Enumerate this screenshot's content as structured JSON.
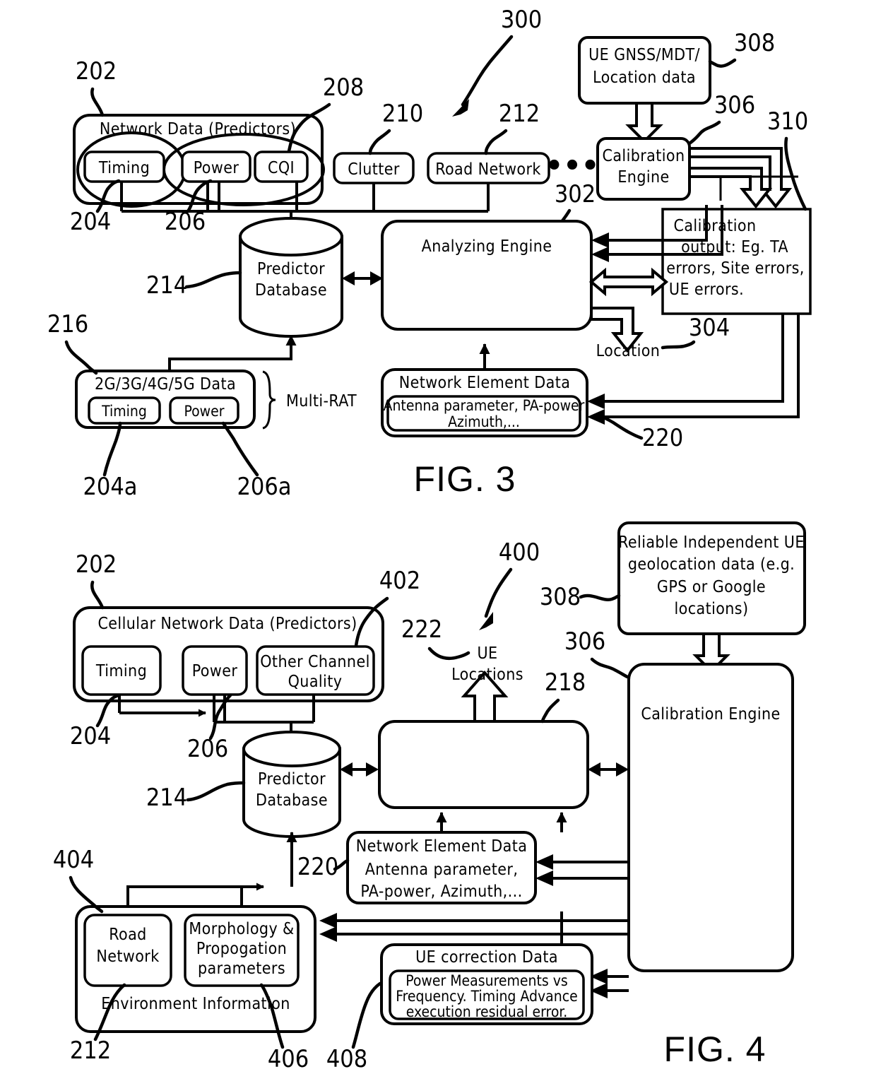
{
  "document": {
    "type": "patent-figure-sheet",
    "figures": [
      "FIG. 3",
      "FIG. 4"
    ]
  },
  "fig3": {
    "caption": "FIG. 3",
    "system_ref": "300",
    "blocks": {
      "network_data": {
        "title": "Network Data  (Predictors)",
        "ref": "202"
      },
      "timing": {
        "label": "Timing",
        "ref": "204"
      },
      "power": {
        "label": "Power",
        "ref": "206"
      },
      "cqi": {
        "label": "CQI",
        "ref": "208"
      },
      "clutter": {
        "label": "Clutter",
        "ref": "210"
      },
      "road_network": {
        "label": "Road  Network",
        "ref": "212"
      },
      "ellipsis": "•••",
      "ellipsis_ref": "302",
      "predictor_db": {
        "label_line1": "Predictor",
        "label_line2": "Database",
        "ref": "214"
      },
      "analyzing_engine": {
        "label": "Analyzing  Engine"
      },
      "ue_gnss": {
        "line1": "UE  GNSS/MDT/",
        "line2": "Location  data",
        "ref": "308"
      },
      "calibration_engine": {
        "line1": "Calibration",
        "line2": "Engine",
        "ref": "306"
      },
      "calibration_output": {
        "line1": "Calibration",
        "line2": "output:  Eg.  TA",
        "line3": "errors,  Site  errors,",
        "line4": "UE  errors.",
        "ref": "310"
      },
      "location_out": {
        "label": "Location",
        "ref": "304"
      },
      "multi_rat": {
        "title": "2G/3G/4G/5G  Data",
        "ref": "216",
        "brace_label": "Multi-RAT",
        "timing": {
          "label": "Timing",
          "ref": "204a"
        },
        "power": {
          "label": "Power",
          "ref": "206a"
        }
      },
      "network_element_data": {
        "title": "Network  Element  Data",
        "inner_line1": "Antenna  parameter,  PA-power",
        "inner_line2": "Azimuth,...",
        "ref": "220"
      }
    }
  },
  "fig4": {
    "caption": "FIG. 4",
    "system_ref": "400",
    "blocks": {
      "cellular_network_data": {
        "title": "Cellular  Network  Data  (Predictors)",
        "ref": "202"
      },
      "timing": {
        "label": "Timing",
        "ref": "204"
      },
      "power": {
        "label": "Power",
        "ref": "206"
      },
      "other_channel_quality": {
        "line1": "Other  Channel",
        "line2": "Quality",
        "ref": "402"
      },
      "predictor_db": {
        "label_line1": "Predictor",
        "label_line2": "Database",
        "ref": "214"
      },
      "analyzing_engine": {
        "label": "",
        "ref": "218"
      },
      "ue_locations": {
        "line1": "UE",
        "line2": "Locations",
        "ref": "222"
      },
      "geolocation_data": {
        "line1": "Reliable  Independent  UE",
        "line2": "geolocation  data  (e.g.",
        "line3": "GPS  or  Google",
        "line4": "locations)",
        "ref": "308"
      },
      "calibration_engine": {
        "label": "Calibration  Engine",
        "ref": "306"
      },
      "network_element_data": {
        "line1": "Network  Element  Data",
        "line2": "Antenna  parameter,",
        "line3": "PA-power,  Azimuth,...",
        "ref": "220"
      },
      "environment_information": {
        "title": "Environment  Information",
        "ref": "404",
        "road_network": {
          "line1": "Road",
          "line2": "Network",
          "ref": "212"
        },
        "morphology": {
          "line1": "Morphology  &",
          "line2": "Propogation",
          "line3": "parameters",
          "ref": "406"
        }
      },
      "ue_correction_data": {
        "title": "UE  correction  Data",
        "inner_line1": "Power  Measurements  vs",
        "inner_line2": "Frequency.  Timing  Advance",
        "inner_line3": "execution  residual  error.",
        "ref": "408"
      }
    }
  }
}
